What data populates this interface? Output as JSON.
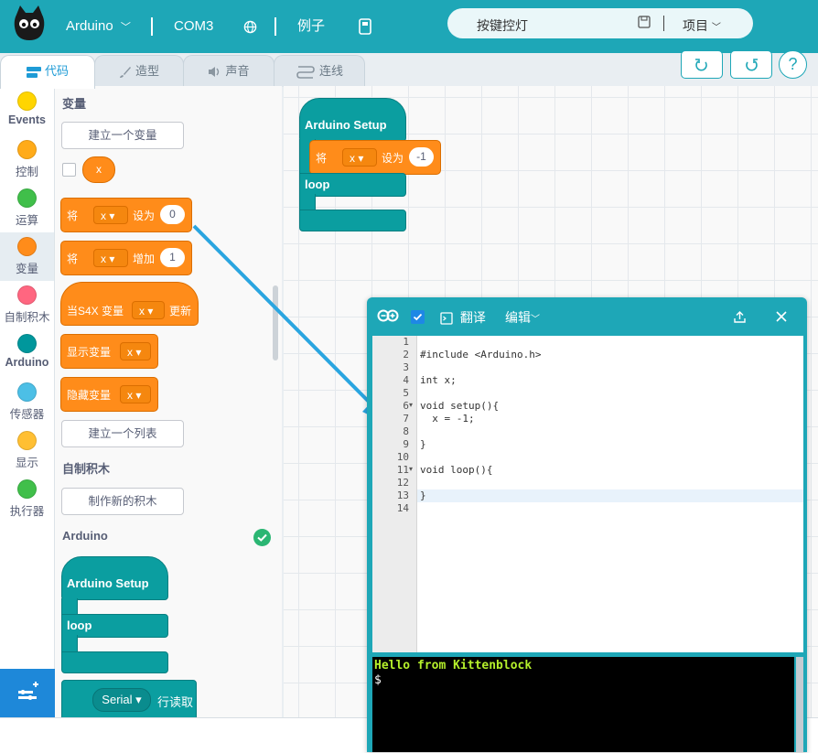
{
  "topbar": {
    "device": "Arduino",
    "port": "COM3",
    "examples": "例子",
    "project_name": "按键控灯",
    "project_menu": "项目"
  },
  "tabs": [
    {
      "label": "代码"
    },
    {
      "label": "造型"
    },
    {
      "label": "声音"
    },
    {
      "label": "连线"
    }
  ],
  "categories": [
    {
      "label": "Events",
      "color": "#ffd500"
    },
    {
      "label": "控制",
      "color": "#ffab19"
    },
    {
      "label": "运算",
      "color": "#40bf4a"
    },
    {
      "label": "变量",
      "color": "#ff8c1a"
    },
    {
      "label": "自制积木",
      "color": "#ff6680"
    },
    {
      "label": "Arduino",
      "color": "#00979c"
    },
    {
      "label": "传感器",
      "color": "#4cbfe6"
    },
    {
      "label": "显示",
      "color": "#ffbf33"
    },
    {
      "label": "执行器",
      "color": "#40bf4a"
    }
  ],
  "palette": {
    "variables_title": "变量",
    "make_variable": "建立一个变量",
    "var_name": "x",
    "set_block": {
      "prefix": "将",
      "var": "x",
      "op": "设为",
      "value": "0"
    },
    "change_block": {
      "prefix": "将",
      "var": "x",
      "op": "增加",
      "value": "1"
    },
    "when_block": {
      "prefix": "当S4X 变量",
      "var": "x",
      "suffix": "更新"
    },
    "show_block": {
      "label": "显示变量",
      "var": "x"
    },
    "hide_block": {
      "label": "隐藏变量",
      "var": "x"
    },
    "make_list": "建立一个列表",
    "myblocks_title": "自制积木",
    "make_block": "制作新的积木",
    "arduino_title": "Arduino",
    "setup_label": "Arduino Setup",
    "loop_label": "loop",
    "serial_label": "Serial",
    "serial_suffix": "行读取"
  },
  "workspace": {
    "setup_label": "Arduino Setup",
    "set_prefix": "将",
    "set_var": "x",
    "set_op": "设为",
    "set_value": "-1",
    "loop_label": "loop"
  },
  "code_window": {
    "translate": "翻译",
    "edit": "编辑",
    "line_numbers": [
      "1",
      "2",
      "3",
      "4",
      "5",
      "6",
      "7",
      "8",
      "9",
      "10",
      "11",
      "12",
      "13",
      "14"
    ],
    "lines": [
      "",
      "#include <Arduino.h>",
      "",
      "int x;",
      "",
      "void setup(){",
      "  x = -1;",
      "",
      "}",
      "",
      "void loop(){",
      "",
      "}",
      ""
    ],
    "console_line1": "Hello from Kittenblock",
    "console_prompt": "$"
  }
}
